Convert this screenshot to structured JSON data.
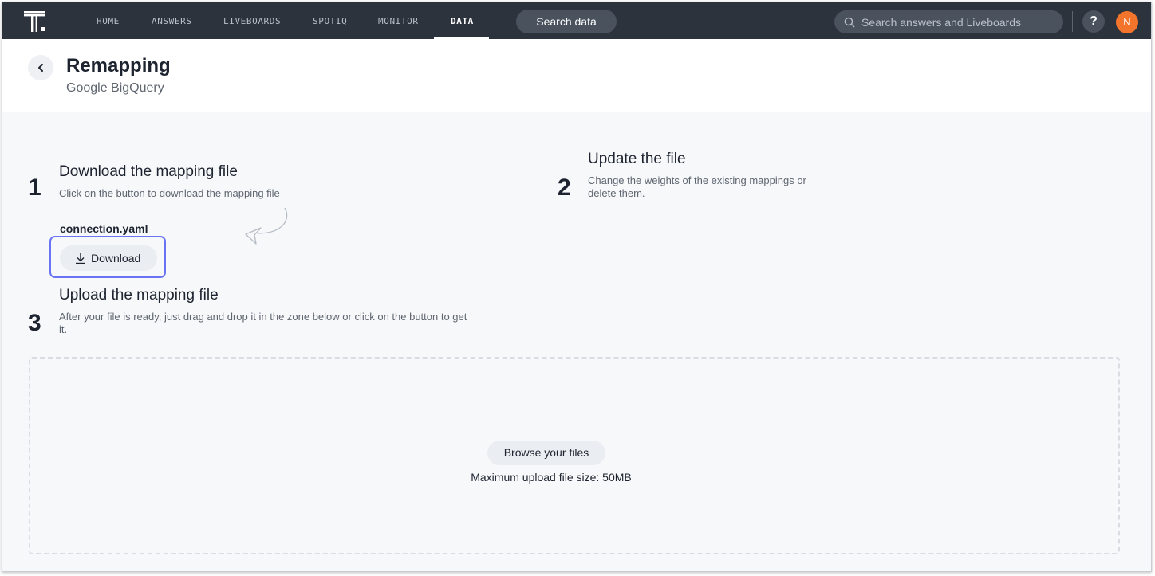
{
  "nav": {
    "items": [
      {
        "label": "HOME"
      },
      {
        "label": "ANSWERS"
      },
      {
        "label": "LIVEBOARDS"
      },
      {
        "label": "SPOTIQ"
      },
      {
        "label": "MONITOR"
      },
      {
        "label": "DATA",
        "active": true
      }
    ],
    "search_data_label": "Search data",
    "global_search_placeholder": "Search answers and Liveboards",
    "help_label": "?",
    "avatar_initial": "N",
    "avatar_color": "#f3752b"
  },
  "header": {
    "title": "Remapping",
    "subtitle": "Google BigQuery"
  },
  "steps": [
    {
      "number": "1",
      "title": "Download the mapping file",
      "description": "Click on the button to download the mapping file"
    },
    {
      "number": "2",
      "title": "Update the file",
      "description": "Change the weights of the existing mappings or delete them."
    },
    {
      "number": "3",
      "title": "Upload the mapping file",
      "description": "After your file is ready, just drag and drop it in the zone below or click on the button to get it."
    }
  ],
  "download": {
    "file_name": "connection.yaml",
    "button_label": "Download"
  },
  "upload": {
    "browse_label": "Browse your files",
    "max_size_text": "Maximum upload file size: 50MB"
  },
  "colors": {
    "nav_background": "#2d333d",
    "focus_ring": "#6a74f2"
  }
}
